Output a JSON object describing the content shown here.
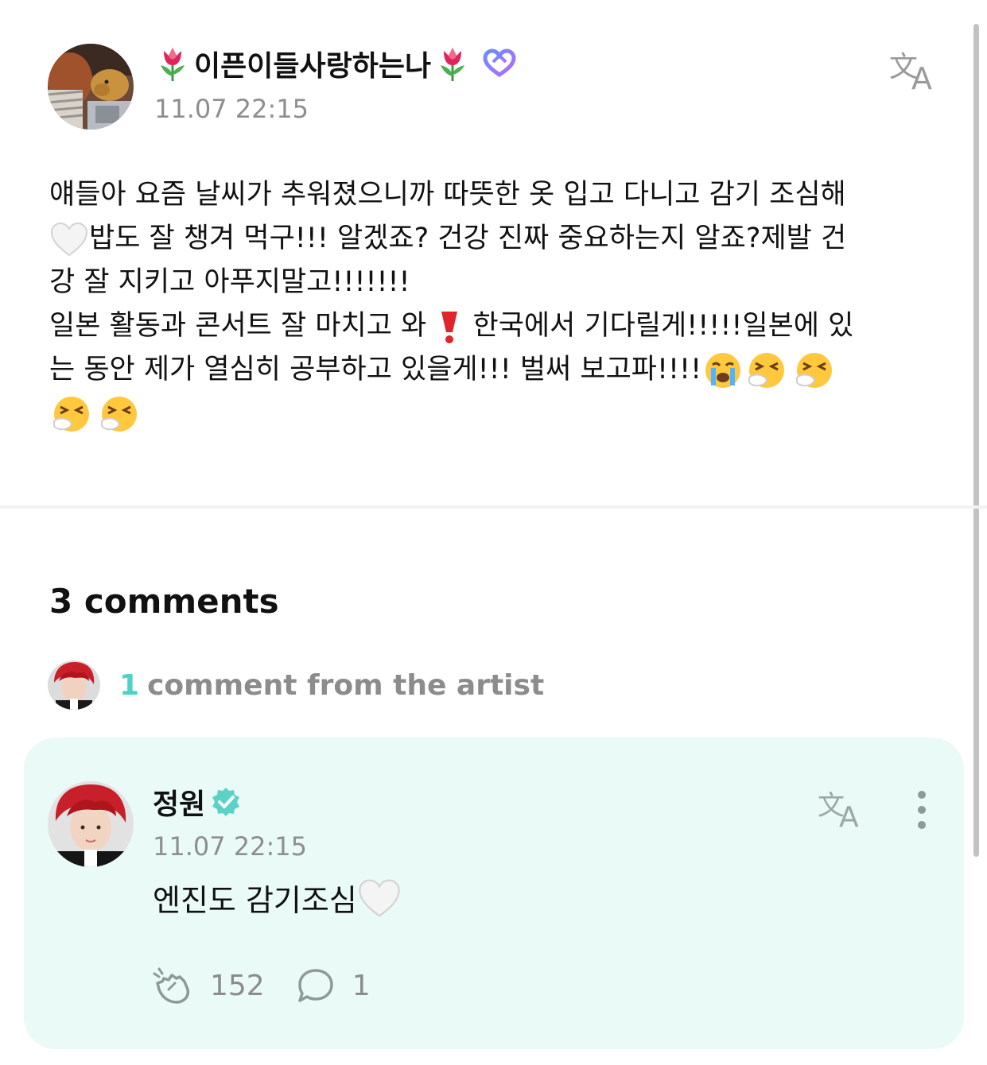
{
  "post": {
    "author": "이픈이들사랑하는나",
    "time": "11.07 22:15",
    "body_line1": "얘들아 요즘 날씨가 추워졌으니까 따뜻한 옷 입고 다니고 감기 조심해",
    "body_line2": "밥도 잘 챙겨 먹구!!! 알겠죠? 건강 진짜 중요하는지 알죠?제발 건",
    "body_line3": "강 잘 지키고 아푸지말고!!!!!!!",
    "body_line4a": "일본 활동과 콘서트 잘 마치고 와",
    "body_line4b": "한국에서 기다릴게!!!!!일본에 있",
    "body_line5": "는 동안 제가 열심히 공부하고 있을게!!! 벌써 보고파!!!!",
    "icons": [
      "tulip-icon",
      "fan-badge-icon",
      "translate-icon",
      "white-heart-emoji",
      "red-exclamation-emoji",
      "crying-face-emoji",
      "sneezing-face-emoji"
    ]
  },
  "comments": {
    "count_label": "3 comments",
    "artist_count": "1",
    "artist_label": "comment from the artist"
  },
  "comment": {
    "author": "정원",
    "time": "11.07 22:15",
    "body": "엔진도 감기조심",
    "likes": "152",
    "replies": "1"
  },
  "colors": {
    "accent": "#4fd1c5",
    "card_bg": "#eafaf7",
    "muted": "#8e8e8e"
  }
}
